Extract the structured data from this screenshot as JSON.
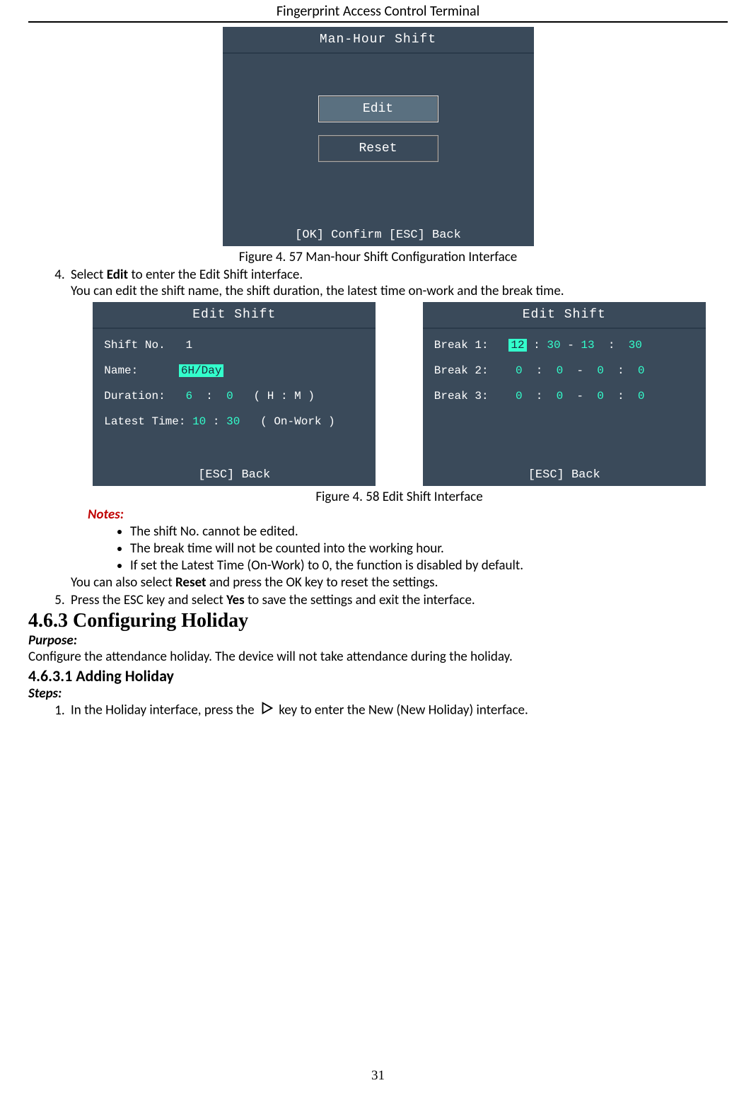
{
  "header": {
    "title": "Fingerprint Access Control Terminal"
  },
  "fig1": {
    "title": "Man-Hour Shift",
    "edit": "Edit",
    "reset": "Reset",
    "footer": "[OK] Confirm   [ESC] Back",
    "caption": "Figure 4. 57 Man-hour Shift Configuration Interface"
  },
  "step4": {
    "line1a": "Select ",
    "bold1": "Edit",
    "line1b": " to enter the Edit Shift interface.",
    "line2": "You can edit the shift name, the shift duration, the latest time on-work and the break time."
  },
  "fig2": {
    "left": {
      "title": "Edit Shift",
      "shift_no_label": "Shift No.",
      "shift_no_value": "1",
      "name_label": "Name:",
      "name_value": "6H/Day",
      "duration_label": "Duration:",
      "duration_h": "6",
      "duration_m": "0",
      "duration_unit": "( H : M )",
      "latest_label": "Latest Time:",
      "latest_h": "10",
      "latest_m": "30",
      "latest_unit": "( On-Work )",
      "footer": "[ESC] Back"
    },
    "right": {
      "title": "Edit Shift",
      "b1_label": "Break 1:",
      "b1_sh": "12",
      "b1_sm": "30",
      "b1_eh": "13",
      "b1_em": "30",
      "b2_label": "Break 2:",
      "b2_sh": "0",
      "b2_sm": "0",
      "b2_eh": "0",
      "b2_em": "0",
      "b3_label": "Break 3:",
      "b3_sh": "0",
      "b3_sm": "0",
      "b3_eh": "0",
      "b3_em": "0",
      "footer": "[ESC] Back"
    },
    "caption": "Figure 4. 58 Edit Shift Interface"
  },
  "notes": {
    "label": "Notes:",
    "b1": "The shift No. cannot be edited.",
    "b2": "The break time will not be counted into the working hour.",
    "b3": "If set the Latest Time (On-Work) to 0, the function is disabled by default.",
    "reset_a": "You can also select ",
    "reset_bold": "Reset",
    "reset_b": " and press the OK key to reset the settings."
  },
  "step5": {
    "a": "Press the ESC key and select ",
    "bold": "Yes",
    "b": " to save the settings and exit the interface."
  },
  "sec463": {
    "title": "4.6.3   Configuring Holiday",
    "purpose_label": "Purpose:",
    "purpose_text": "Configure the attendance holiday. The device will not take attendance during the holiday."
  },
  "sec4631": {
    "title": "4.6.3.1 Adding Holiday",
    "steps_label": "Steps:",
    "s1_a": "In the Holiday interface, press the",
    "s1_b": "key to enter the New (New Holiday) interface."
  },
  "page_number": "31"
}
